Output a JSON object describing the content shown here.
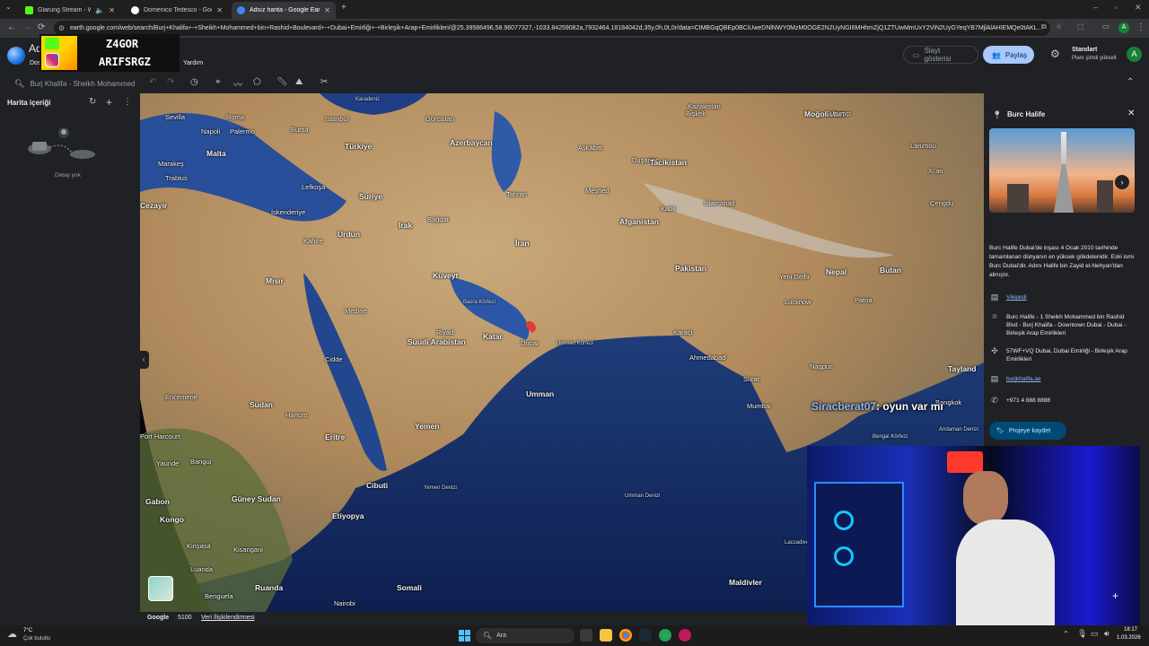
{
  "browser": {
    "tabs": [
      {
        "title": "Glarung Stream - Watch Li",
        "color": "#53fc18"
      },
      {
        "title": "Domenico Tedesco - Google'd",
        "color": "#4285f4"
      },
      {
        "title": "Adsız harita - Google Earth",
        "color": "#4285f4"
      }
    ],
    "url": "earth.google.com/web/search/Burj+Khalifa+-+Sheikh+Mohammed+bin+Rashid+Boulevard+-+Dubai+Emirliği+-+Birleşik+Arap+Emirlikleri/@25.39586496,58.96077327,-1033.84259082a,7932464.18184042d,35y,0h,0t,0r/data=CtMBGqQBEp0BCiUweDNlNWY0MzM0OGE2N2UyNGI6MHhmZjQ1ZTUwMmUxY2ViN2UyGYeqYB7MjlAlAHIEMQe0tAKL..."
  },
  "overlay": {
    "streamer_line1": "Z4GOR",
    "streamer_line2": "ARIFSRGZ"
  },
  "earth": {
    "title_partial": "Ad",
    "menu_partial": "Dos",
    "help_menu": "Yardım",
    "slideshow": "Slayt gösterisi",
    "share": "Paylaş",
    "plan_name": "Standart",
    "plan_upgrade": "Planı şimdi yükselt",
    "avatar_letter": "A",
    "search_value": "Burj Khalifa - Sheikh Mohammed"
  },
  "leftpanel": {
    "title": "Harita içeriği",
    "empty": "Detay yok"
  },
  "map": {
    "labels": [
      {
        "t": "Karadeniz",
        "cls": "sea"
      },
      {
        "t": "Gürcistan",
        "cls": ""
      },
      {
        "t": "Kazakistan",
        "cls": ""
      },
      {
        "t": "Moğolistan",
        "cls": "big"
      },
      {
        "t": "Sevilla",
        "cls": ""
      },
      {
        "t": "Roma",
        "cls": ""
      },
      {
        "t": "İstanbul",
        "cls": ""
      },
      {
        "t": "Azerbaycan",
        "cls": "big"
      },
      {
        "t": "Bişkek",
        "cls": ""
      },
      {
        "t": "Urumçi",
        "cls": ""
      },
      {
        "t": "Napoli",
        "cls": ""
      },
      {
        "t": "Bursa",
        "cls": ""
      },
      {
        "t": "Palermo",
        "cls": ""
      },
      {
        "t": "Türkiye",
        "cls": "big"
      },
      {
        "t": "Duşanbe",
        "cls": ""
      },
      {
        "t": "Tacikistan",
        "cls": "big"
      },
      {
        "t": "Lanzhou",
        "cls": ""
      },
      {
        "t": "Marakeş",
        "cls": ""
      },
      {
        "t": "Malta",
        "cls": "big"
      },
      {
        "t": "Aşkabat",
        "cls": ""
      },
      {
        "t": "Meşhed",
        "cls": ""
      },
      {
        "t": "Kabil",
        "cls": ""
      },
      {
        "t": "Xi'an",
        "cls": ""
      },
      {
        "t": "Trablus",
        "cls": ""
      },
      {
        "t": "Lefkoşa",
        "cls": ""
      },
      {
        "t": "Suriye",
        "cls": "big"
      },
      {
        "t": "Tahran",
        "cls": ""
      },
      {
        "t": "İslamabad",
        "cls": ""
      },
      {
        "t": "Çengdu",
        "cls": ""
      },
      {
        "t": "Cezayir",
        "cls": "big"
      },
      {
        "t": "İskenderiye",
        "cls": ""
      },
      {
        "t": "Bağdat",
        "cls": ""
      },
      {
        "t": "Afganistan",
        "cls": "big"
      },
      {
        "t": "Kahire",
        "cls": ""
      },
      {
        "t": "Urdun",
        "cls": "big"
      },
      {
        "t": "Irak",
        "cls": "big"
      },
      {
        "t": "İran",
        "cls": "big"
      },
      {
        "t": "Pakistan",
        "cls": "big"
      },
      {
        "t": "Nepal",
        "cls": "big"
      },
      {
        "t": "Butan",
        "cls": "big"
      },
      {
        "t": "Mısır",
        "cls": "big"
      },
      {
        "t": "Kuveyt",
        "cls": "big"
      },
      {
        "t": "Yeni Delhi",
        "cls": ""
      },
      {
        "t": "Basra Körfezi",
        "cls": "sea"
      },
      {
        "t": "Lucknow",
        "cls": ""
      },
      {
        "t": "Medine",
        "cls": ""
      },
      {
        "t": "Katar",
        "cls": "big"
      },
      {
        "t": "Dubai",
        "cls": ""
      },
      {
        "t": "Patna",
        "cls": ""
      },
      {
        "t": "Riyad",
        "cls": ""
      },
      {
        "t": "Karaçi",
        "cls": ""
      },
      {
        "t": "Suudi Arabistan",
        "cls": "big"
      },
      {
        "t": "Umman Körfezi",
        "cls": "sea"
      },
      {
        "t": "Ahmedabad",
        "cls": ""
      },
      {
        "t": "Cidde",
        "cls": ""
      },
      {
        "t": "Nagpur",
        "cls": ""
      },
      {
        "t": "Umman",
        "cls": "big"
      },
      {
        "t": "Surat",
        "cls": ""
      },
      {
        "t": "Mumbai",
        "cls": ""
      },
      {
        "t": "Encemene",
        "cls": ""
      },
      {
        "t": "Sudan",
        "cls": "big"
      },
      {
        "t": "Hartum",
        "cls": ""
      },
      {
        "t": "Port Harcourt",
        "cls": ""
      },
      {
        "t": "Eritre",
        "cls": "big"
      },
      {
        "t": "Yemen",
        "cls": "big"
      },
      {
        "t": "Yaunde",
        "cls": ""
      },
      {
        "t": "Bangui",
        "cls": ""
      },
      {
        "t": "Cibuti",
        "cls": "big"
      },
      {
        "t": "Yemen Denizi",
        "cls": "sea"
      },
      {
        "t": "Gabon",
        "cls": "big"
      },
      {
        "t": "Güney Sudan",
        "cls": "big"
      },
      {
        "t": "Etiyopya",
        "cls": "big"
      },
      {
        "t": "Kongo",
        "cls": "big"
      },
      {
        "t": "Umman Denizi",
        "cls": "sea"
      },
      {
        "t": "Bengal Körfezi",
        "cls": "sea"
      },
      {
        "t": "Andaman Denizi",
        "cls": "sea"
      },
      {
        "t": "Bangkok",
        "cls": ""
      },
      {
        "t": "Tayland",
        "cls": "big"
      },
      {
        "t": "Kinşasa",
        "cls": ""
      },
      {
        "t": "Kisangani",
        "cls": ""
      },
      {
        "t": "Luanda",
        "cls": ""
      },
      {
        "t": "Ruanda",
        "cls": "big"
      },
      {
        "t": "Somali",
        "cls": "big"
      },
      {
        "t": "Nairobi",
        "cls": ""
      },
      {
        "t": "Benguela",
        "cls": ""
      },
      {
        "t": "Maldivler",
        "cls": "big"
      },
      {
        "t": "Laccadive Denizi",
        "cls": "sea"
      }
    ],
    "chat_user": "Siracberat07",
    "chat_msg": ": oyun var mı"
  },
  "footer": {
    "brand": "Google",
    "scale": "5100",
    "data_credit": "Veri İlişkilendirmesi"
  },
  "infopanel": {
    "title": "Burc Halife",
    "description": "Burc Halife Dubai'de inşası 4 Ocak 2010 tarihinde tamamlanan dünyanın en yüksek gökdelenidir. Eski ismi Burc Dubai'dir. Adını Halife bin Zayid el-Nehyan'dan almıştır.",
    "wiki": "Vikipedi",
    "address": "Burc Halife - 1 Sheikh Mohammed bin Rashid Blvd - Burj Khalifa - Downtown Dubai - Dubai - Birleşik Arap Emirlikleri",
    "pluscode": "57WF+VQ Dubai, Dubai Emirliği - Birleşik Arap Emirlikleri",
    "website": "burjkhalifa.ae",
    "phone": "+971 4 888 8888",
    "save_button": "Projeye kaydet"
  },
  "taskbar": {
    "weather_temp": "7°C",
    "weather_desc": "Çok bulutlu",
    "search_placeholder": "Ara",
    "time": "18:17",
    "date": "1.03.2026"
  },
  "colors": {
    "accent": "#8ab4f8",
    "share_bg": "#a8c7fa",
    "save_bg": "#004a77",
    "marker": "#e53935"
  }
}
